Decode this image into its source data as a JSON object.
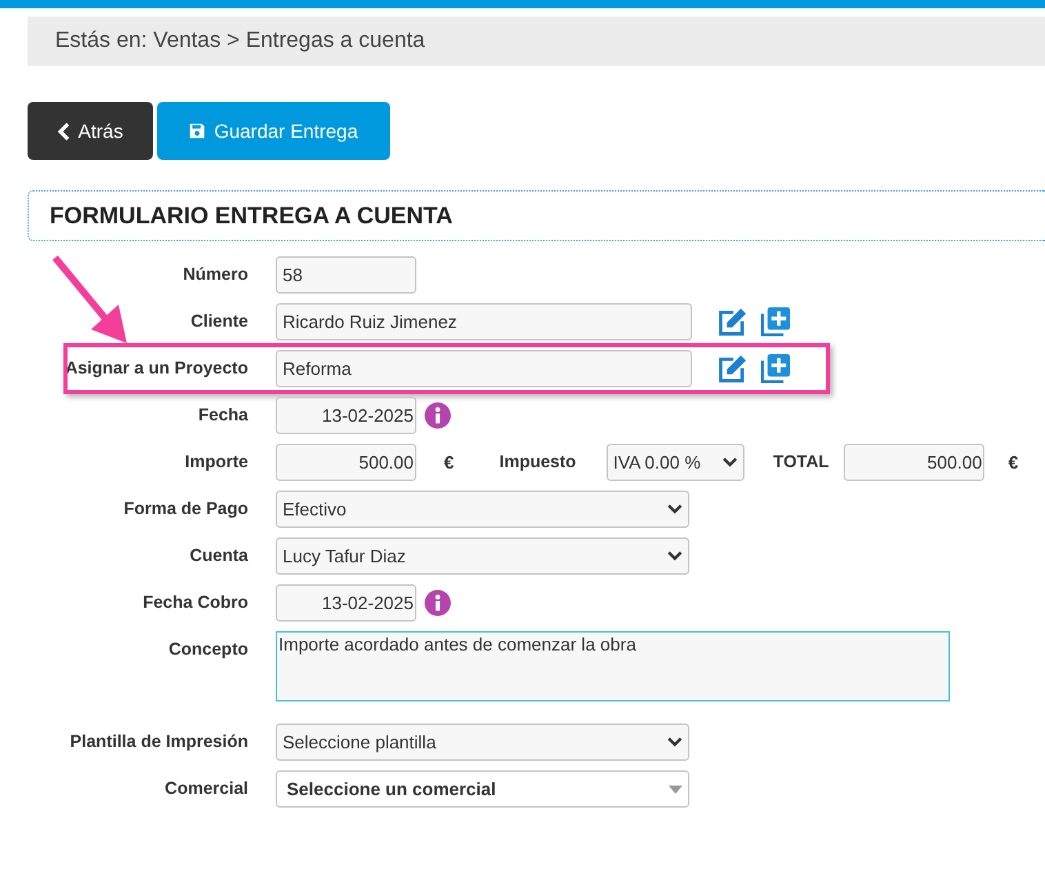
{
  "breadcrumb": "Estás en: Ventas > Entregas a cuenta",
  "buttons": [
    {
      "label": "Atrás",
      "kind": "back"
    },
    {
      "label": "Guardar Entrega",
      "kind": "save"
    }
  ],
  "form": {
    "title": "FORMULARIO ENTREGA A CUENTA",
    "rows": [
      {
        "kind": "text",
        "label": "Número",
        "value": "58",
        "highlighted": false
      },
      {
        "kind": "text-actions",
        "label": "Cliente",
        "value": "Ricardo Ruiz Jimenez",
        "highlighted": false
      },
      {
        "kind": "text-actions",
        "label": "Asignar a un Proyecto",
        "value": "Reforma",
        "highlighted": true
      },
      {
        "kind": "date",
        "label": "Fecha",
        "value": "13-02-2025",
        "highlighted": false
      },
      {
        "kind": "amount",
        "label": "Importe",
        "value": "500.00",
        "currency": "€",
        "tax_label": "Impuesto",
        "tax": "IVA 0.00 %",
        "total_label": "TOTAL",
        "total": "500.00",
        "total_currency": "€",
        "highlighted": false
      },
      {
        "kind": "select",
        "label": "Forma de Pago",
        "value": "Efectivo",
        "highlighted": false
      },
      {
        "kind": "select",
        "label": "Cuenta",
        "value": "Lucy Tafur Diaz",
        "highlighted": false
      },
      {
        "kind": "date",
        "label": "Fecha Cobro",
        "value": "13-02-2025",
        "highlighted": false
      },
      {
        "kind": "textarea",
        "label": "Concepto",
        "value": "Importe acordado antes de comenzar la obra",
        "highlighted": false
      },
      {
        "kind": "select",
        "label": "Plantilla de Impresión",
        "value": "Seleccione plantilla",
        "highlighted": false
      },
      {
        "kind": "combo",
        "label": "Comercial",
        "value": "Seleccione un comercial",
        "highlighted": false
      }
    ]
  }
}
